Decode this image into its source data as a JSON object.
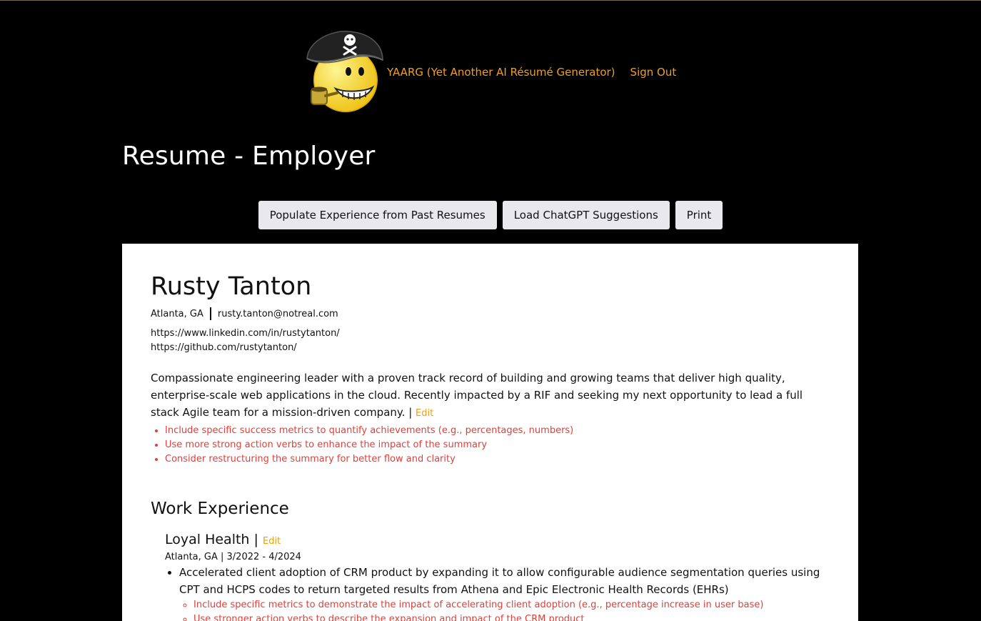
{
  "app": {
    "title_link": "YAARG (Yet Another AI Résumé Generator)",
    "signout_link": "Sign Out"
  },
  "page": {
    "title": "Resume - Employer"
  },
  "toolbar": {
    "populate_label": "Populate Experience from Past Resumes",
    "load_label": "Load ChatGPT Suggestions",
    "print_label": "Print"
  },
  "resume": {
    "name": "Rusty Tanton",
    "location": "Atlanta, GA",
    "email": "rusty.tanton@notreal.com",
    "linkedin": "https://www.linkedin.com/in/rustytanton/",
    "github": "https://github.com/rustytanton/",
    "summary": "Compassionate engineering leader with a proven track record of building and growing teams that deliver high quality, enterprise-scale web applications in the cloud. Recently impacted by a RIF and seeking my next opportunity to lead a full stack Agile team for a mission-driven company.",
    "summary_pipe": "|",
    "edit_label": "Edit",
    "summary_suggestions": [
      "Include specific success metrics to quantify achievements (e.g., percentages, numbers)",
      "Use more strong action verbs to enhance the impact of the summary",
      "Consider restructuring the summary for better flow and clarity"
    ],
    "work_title": "Work Experience",
    "jobs": [
      {
        "employer": "Loyal Health",
        "pipe": "|",
        "edit_label": "Edit",
        "meta": "Atlanta, GA | 3/2022 - 4/2024",
        "bullets": [
          {
            "text": "Accelerated client adoption of CRM product by expanding it to allow configurable audience segmentation queries using CPT and HCPS codes to return targeted results from Athena and Epic Electronic Health Records (EHRs)",
            "suggestions": [
              "Include specific metrics to demonstrate the impact of accelerating client adoption (e.g., percentage increase in user base)",
              "Use stronger action verbs to describe the expansion and impact of the CRM product"
            ]
          }
        ]
      }
    ]
  },
  "colors": {
    "background": "#000000",
    "accent_link": "#f0a020",
    "suggestion_red": "#e0403a",
    "paper": "#ffffff",
    "button_bg": "#e9e9ed"
  },
  "icons": {
    "logo": "pirate-smiley-logo"
  }
}
